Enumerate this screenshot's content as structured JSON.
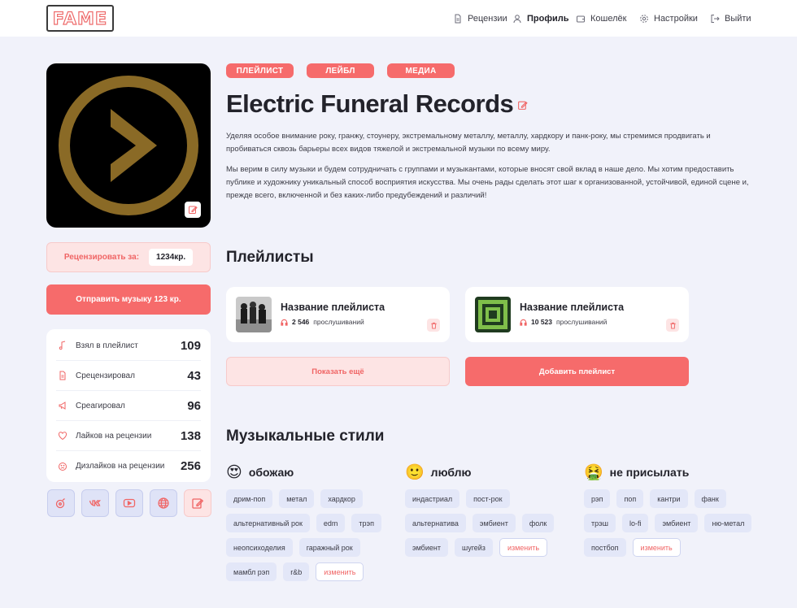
{
  "header": {
    "logo": "FAME",
    "nav": [
      {
        "label": "Рецензии",
        "icon": "document-icon"
      },
      {
        "label": "Профиль",
        "icon": "user-icon"
      },
      {
        "label": "Кошелёк",
        "icon": "wallet-icon"
      },
      {
        "label": "Настройки",
        "icon": "gear-icon"
      },
      {
        "label": "Выйти",
        "icon": "logout-icon"
      }
    ]
  },
  "sidebar": {
    "review_price_label": "Рецензировать за:",
    "review_price_value": "1234кр.",
    "send_music_label": "Отправить музыку 123 кр.",
    "stats": [
      {
        "label": "Взял в плейлист",
        "value": "109",
        "icon": "music-note-icon"
      },
      {
        "label": "Срецензировал",
        "value": "43",
        "icon": "document-icon"
      },
      {
        "label": "Среагировал",
        "value": "96",
        "icon": "megaphone-icon"
      },
      {
        "label": "Лайков на рецензии",
        "value": "138",
        "icon": "heart-icon"
      },
      {
        "label": "Дизлайков на рецензии",
        "value": "256",
        "icon": "sad-face-icon"
      }
    ],
    "socials": [
      "music-app-icon",
      "vk-icon",
      "youtube-icon",
      "globe-icon",
      "edit-icon"
    ]
  },
  "profile": {
    "tags": [
      "ПЛЕЙЛИСТ",
      "ЛЕЙБЛ",
      "МЕДИА"
    ],
    "title": "Electric Funeral Records",
    "description_1": "Уделяя особое внимание року, гранжу, стоунеру, экстремальному металлу, металлу, хардкору и панк-року, мы стремимся продвигать и пробиваться сквозь барьеры всех видов тяжелой и экстремальной музыки по всему миру.",
    "description_2": "Мы верим в силу музыки и будем сотрудничать с группами и музыкантами, которые вносят свой вклад в наше дело. Мы хотим предоставить публике и художнику уникальный способ восприятия искусства. Мы очень рады сделать этот шаг к организованной, устойчивой, единой сцене и, прежде всего, включенной и без каких-либо предубеждений и различий!"
  },
  "playlists": {
    "heading": "Плейлисты",
    "items": [
      {
        "name": "Название плейлиста",
        "listens": "2 546",
        "listens_suffix": "прослушиваний"
      },
      {
        "name": "Название плейлиста",
        "listens": "10 523",
        "listens_suffix": "прослушиваний"
      }
    ],
    "show_more_label": "Показать ещё",
    "add_label": "Добавить плейлист"
  },
  "styles": {
    "heading": "Музыкальные стили",
    "columns": [
      {
        "emoji": "😍",
        "name": "обожаю",
        "chips": [
          "дрим-поп",
          "метал",
          "хардкор",
          "альтернативный рок",
          "edm",
          "трэп",
          "неопсиходелия",
          "гаражный рок",
          "мамбл рэп",
          "r&b"
        ]
      },
      {
        "emoji": "🙂",
        "name": "люблю",
        "chips": [
          "индастриал",
          "пост-рок",
          "альтернатива",
          "эмбиент",
          "фолк",
          "эмбиент",
          "шугейз"
        ]
      },
      {
        "emoji": "🤮",
        "name": "не присылать",
        "chips": [
          "рэп",
          "поп",
          "кантри",
          "фанк",
          "трэш",
          "lo-fi",
          "эмбиент",
          "ню-метал",
          "постбоп"
        ]
      }
    ],
    "change_label": "изменить"
  }
}
